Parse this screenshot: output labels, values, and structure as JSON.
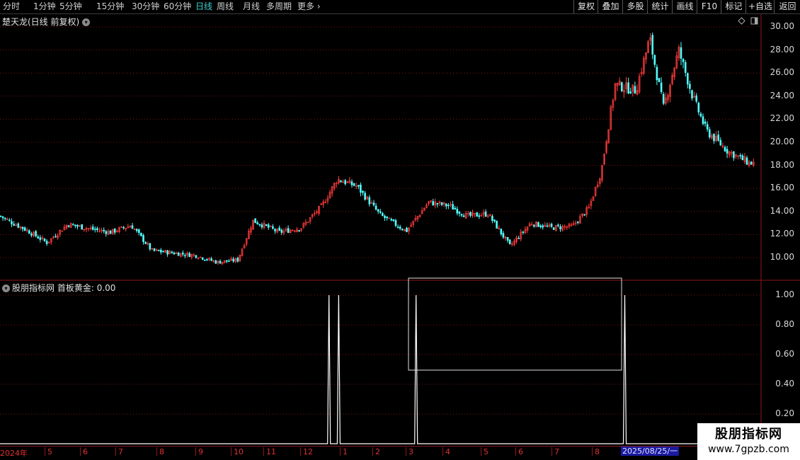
{
  "toolbar": {
    "periods": [
      "分时",
      "1分钟",
      "5分钟",
      "15分钟",
      "30分钟",
      "60分钟",
      "日线",
      "周线",
      "月线",
      "多周期",
      "更多"
    ],
    "active_period": "日线",
    "right_buttons": [
      "复权",
      "叠加",
      "多股",
      "统计",
      "画线",
      "F10",
      "标记",
      "+自选",
      "返回"
    ]
  },
  "main_chart": {
    "title": "楚天龙(日线 前复权)",
    "y_ticks": [
      "30.00",
      "28.00",
      "26.00",
      "24.00",
      "22.00",
      "20.00",
      "18.00",
      "16.00",
      "14.00",
      "12.00",
      "10.00"
    ]
  },
  "indicator": {
    "name": "股朋指标网",
    "line_label": "首板黄金:",
    "line_value": "0.00",
    "y_ticks": [
      "1.00",
      "0.80",
      "0.60",
      "0.40",
      "0.20"
    ]
  },
  "date_axis": {
    "ticks": [
      "2024年",
      "5",
      "6",
      "7",
      "8",
      "9",
      "10",
      "11",
      "12",
      "1",
      "2",
      "3",
      "4",
      "5",
      "6",
      "7",
      "8"
    ],
    "current": "2025/08/25/一"
  },
  "watermark": {
    "title": "股朋指标网",
    "url": "www.7gpzb.com"
  },
  "colors": {
    "up": "#ff3c3c",
    "down": "#54ffff",
    "grid": "#8b1a1a",
    "indicator_line": "#ffffff"
  },
  "chart_data": [
    {
      "type": "candlestick",
      "title": "楚天龙(日线 前复权)",
      "ylim": [
        9,
        30.5
      ],
      "y_ticks": [
        10,
        12,
        14,
        16,
        18,
        20,
        22,
        24,
        26,
        28,
        30
      ],
      "x_axis": [
        "2024年",
        "5",
        "6",
        "7",
        "8",
        "9",
        "10",
        "11",
        "12",
        "1",
        "2",
        "3",
        "4",
        "5",
        "6",
        "7",
        "8"
      ],
      "close_path": [
        [
          "2024-04",
          13.6
        ],
        [
          "2024-04-20",
          12.4
        ],
        [
          "2024-05-05",
          11.3
        ],
        [
          "2024-05-20",
          12.9
        ],
        [
          "2024-06-05",
          12.5
        ],
        [
          "2024-06-20",
          12.2
        ],
        [
          "2024-07-05",
          12.8
        ],
        [
          "2024-07-20",
          10.6
        ],
        [
          "2024-08-05",
          10.4
        ],
        [
          "2024-08-20",
          10.2
        ],
        [
          "2024-09-05",
          9.6
        ],
        [
          "2024-09-20",
          9.8
        ],
        [
          "2024-10-01",
          13.2
        ],
        [
          "2024-10-20",
          12.2
        ],
        [
          "2024-11-05",
          12.6
        ],
        [
          "2024-11-20",
          14.5
        ],
        [
          "2024-12-01",
          16.8
        ],
        [
          "2024-12-15",
          16.2
        ],
        [
          "2025-01-01",
          13.7
        ],
        [
          "2025-01-20",
          12.3
        ],
        [
          "2025-02-05",
          14.8
        ],
        [
          "2025-02-20",
          14.5
        ],
        [
          "2025-03-05",
          13.6
        ],
        [
          "2025-03-20",
          13.8
        ],
        [
          "2025-04-05",
          11.0
        ],
        [
          "2025-04-20",
          13.0
        ],
        [
          "2025-05-05",
          12.6
        ],
        [
          "2025-05-20",
          12.7
        ],
        [
          "2025-06-01",
          14.3
        ],
        [
          "2025-06-10",
          17.5
        ],
        [
          "2025-06-20",
          25.0
        ],
        [
          "2025-07-05",
          24.5
        ],
        [
          "2025-07-15",
          29.0
        ],
        [
          "2025-07-25",
          23.0
        ],
        [
          "2025-08-05",
          28.0
        ],
        [
          "2025-08-15",
          24.0
        ],
        [
          "2025-08-25",
          21.0
        ],
        [
          "2025-09-10",
          19.2
        ],
        [
          "2025-09-25",
          18.2
        ]
      ]
    },
    {
      "type": "line",
      "name": "首板黄金",
      "ylim": [
        0,
        1.05
      ],
      "y_ticks": [
        0.2,
        0.4,
        0.6,
        0.8,
        1.0
      ],
      "spikes": [
        {
          "date": "2024-11-25",
          "value": 1.0
        },
        {
          "date": "2024-12-02",
          "value": 1.0
        },
        {
          "date": "2025-01-27",
          "value": 1.0
        },
        {
          "date": "2025-06-27",
          "value": 1.0
        }
      ],
      "baseline": 0
    }
  ]
}
